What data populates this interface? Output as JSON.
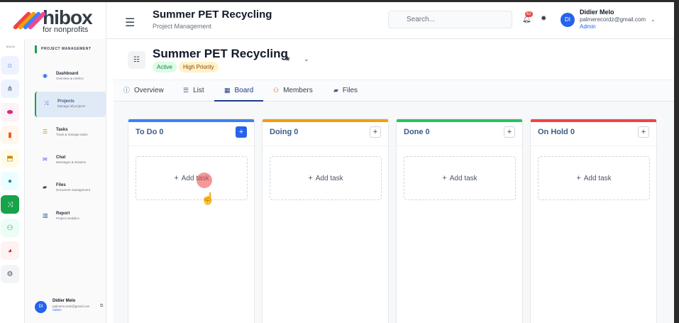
{
  "brand": {
    "name": "hibox",
    "tagline": "for nonprofits"
  },
  "header": {
    "title": "Summer PET Recycling",
    "subtitle": "Project Management",
    "search_placeholder": "Search...",
    "notification_count": "62",
    "user": {
      "initials": "DI",
      "name": "Didier Melo",
      "email": "palmerecordz@gmail.com",
      "role": "Admin"
    }
  },
  "rail": {
    "label": "MAIN",
    "icons": [
      "home-icon",
      "sitemap-icon",
      "capsule-icon",
      "book-icon",
      "graduation-icon",
      "circle-icon",
      "projects-icon",
      "users-icon",
      "chart-pie-icon",
      "gear-icon"
    ]
  },
  "subsidebar": {
    "heading": "PROJECT MANAGEMENT",
    "items": [
      {
        "title": "Dashboard",
        "desc": "Overview & metrics"
      },
      {
        "title": "Projects",
        "desc": "Manage all projects"
      },
      {
        "title": "Tasks",
        "desc": "Track & manage tasks"
      },
      {
        "title": "Chat",
        "desc": "Messages & streams"
      },
      {
        "title": "Files",
        "desc": "Document management"
      },
      {
        "title": "Report",
        "desc": "Project analytics"
      }
    ],
    "user": {
      "initials": "DI",
      "name": "Didier Melo",
      "email": "palmerecordz@gmail.com",
      "role": "Admin"
    }
  },
  "project": {
    "title": "Summer PET Recycling",
    "status": "Active",
    "priority": "High Priority"
  },
  "tabs": [
    {
      "label": "Overview",
      "icon": "info-icon"
    },
    {
      "label": "List",
      "icon": "list-icon"
    },
    {
      "label": "Board",
      "icon": "board-icon"
    },
    {
      "label": "Members",
      "icon": "members-icon"
    },
    {
      "label": "Files",
      "icon": "folder-icon"
    }
  ],
  "active_tab": "Board",
  "columns": [
    {
      "title": "To Do 0",
      "color": "#3b82f6",
      "add_label": "Add task"
    },
    {
      "title": "Doing 0",
      "color": "#f59e0b",
      "add_label": "Add task"
    },
    {
      "title": "Done 0",
      "color": "#22c55e",
      "add_label": "Add task"
    },
    {
      "title": "On Hold 0",
      "color": "#ef4444",
      "add_label": "Add task"
    }
  ]
}
